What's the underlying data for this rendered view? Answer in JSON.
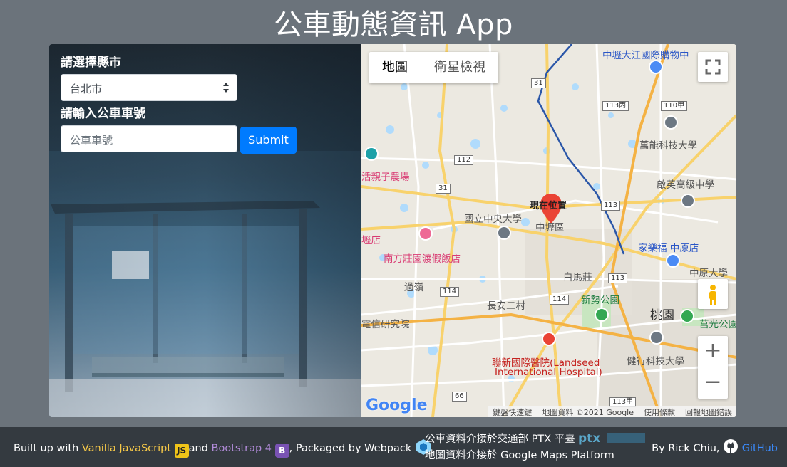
{
  "app": {
    "title": "公車動態資訊 App"
  },
  "form": {
    "city_label": "請選擇縣市",
    "city_selected": "台北市",
    "route_label": "請輸入公車車號",
    "route_placeholder": "公車車號",
    "submit_label": "Submit"
  },
  "map": {
    "type_map": "地圖",
    "type_satellite": "衛星檢視",
    "pin_label": "現在位置",
    "footer": {
      "shortcuts": "鍵盤快速鍵",
      "data": "地圖資料 ©2021 Google",
      "terms": "使用條款",
      "report": "回報地圖錯誤"
    },
    "logo": "Google",
    "places": {
      "ntcu": "國立中央大學",
      "zhongli": "中壢區",
      "taoyuan": "桃園",
      "nanfang": "南方莊園渡假飯店",
      "landseed": "聯新國際醫院(Landseed",
      "landseed2": "International Hospital)",
      "xinshi": "新勢公園",
      "wanneng": "萬能科技大學",
      "qiying": "啟英高級中學",
      "carrefour": "家樂福 中原店",
      "zhongyuan": "中原大學",
      "jianxing": "健行科技大學",
      "global_mall": "中壢大江國際購物中",
      "farm": "活親子農場",
      "research": "電信研究院",
      "youdian": "壢店",
      "ludi": "過嶺",
      "changan": "長安二村",
      "baima": "白馬莊",
      "xingguang": "莒光公園"
    },
    "routes": [
      "31",
      "113丙",
      "110甲",
      "112",
      "31",
      "113",
      "114",
      "114",
      "113",
      "113甲",
      "66"
    ]
  },
  "footer": {
    "built_prefix": "Built up with",
    "js_label": "Vanilla JavaScript",
    "js_badge": "JS",
    "and": "and",
    "bs_label": "Bootstrap 4",
    "bs_badge": "B",
    "packaged": ", Packaged by Webpack",
    "ptx_line": "公車資料介接於交通部 PTX 平臺",
    "gmaps_line": "地圖資料介接於 Google Maps Platform",
    "author": "By Rick Chiu,",
    "github": "GitHub"
  }
}
